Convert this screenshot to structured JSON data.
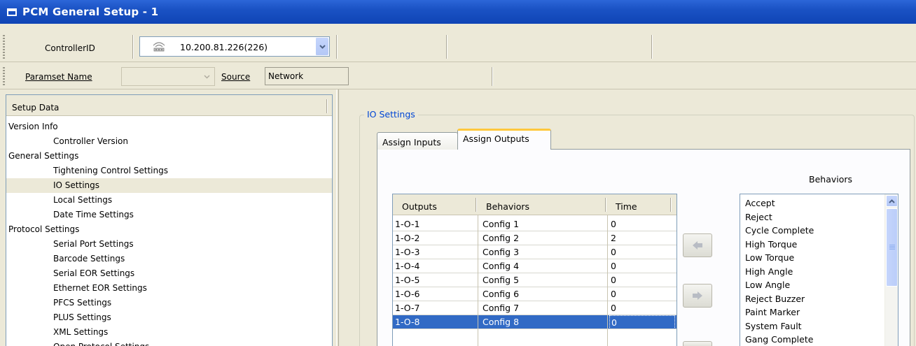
{
  "window": {
    "title": "PCM General Setup - 1"
  },
  "toolbar": {
    "controller_label": "ControllerID",
    "controller_value": "10.200.81.226(226)",
    "controller_icon": "network-icon",
    "paramset_label": "Paramset Name",
    "paramset_value": "",
    "source_label": "Source",
    "source_value": "Network"
  },
  "setup_tree": {
    "header": "Setup Data",
    "items": [
      {
        "label": "Version Info",
        "level": 0
      },
      {
        "label": "Controller Version",
        "level": 1
      },
      {
        "label": "General Settings",
        "level": 0
      },
      {
        "label": "Tightening Control Settings",
        "level": 1
      },
      {
        "label": "IO Settings",
        "level": 1,
        "selected": true
      },
      {
        "label": "Local Settings",
        "level": 1
      },
      {
        "label": "Date Time Settings",
        "level": 1
      },
      {
        "label": "Protocol Settings",
        "level": 0
      },
      {
        "label": "Serial Port Settings",
        "level": 1
      },
      {
        "label": "Barcode Settings",
        "level": 1
      },
      {
        "label": "Serial EOR Settings",
        "level": 1
      },
      {
        "label": "Ethernet EOR Settings",
        "level": 1
      },
      {
        "label": "PFCS Settings",
        "level": 1
      },
      {
        "label": "PLUS Settings",
        "level": 1
      },
      {
        "label": "XML Settings",
        "level": 1
      },
      {
        "label": "Open Protocol Settings",
        "level": 1
      }
    ]
  },
  "io_settings": {
    "group_title": "IO Settings",
    "tabs": [
      {
        "label": "Assign Inputs",
        "active": false
      },
      {
        "label": "Assign Outputs",
        "active": true
      }
    ],
    "outputs_table": {
      "columns": [
        "Outputs",
        "Behaviors",
        "Time"
      ],
      "rows": [
        [
          "1-O-1",
          "Config 1",
          "0"
        ],
        [
          "1-O-2",
          "Config 2",
          "2"
        ],
        [
          "1-O-3",
          "Config 3",
          "0"
        ],
        [
          "1-O-4",
          "Config 4",
          "0"
        ],
        [
          "1-O-5",
          "Config 5",
          "0"
        ],
        [
          "1-O-6",
          "Config 6",
          "0"
        ],
        [
          "1-O-7",
          "Config 7",
          "0"
        ],
        [
          "1-O-8",
          "Config 8",
          "0"
        ]
      ],
      "selected_row": 7
    },
    "behaviors": {
      "caption": "Behaviors",
      "items": [
        "Accept",
        "Reject",
        "Cycle Complete",
        "High Torque",
        "Low Torque",
        "High Angle",
        "Low Angle",
        "Reject Buzzer",
        "Paint Marker",
        "System Fault",
        "Gang Complete"
      ]
    },
    "buttons": {
      "assign_left_icon": "arrow-left-icon",
      "assign_right_icon": "arrow-right-icon"
    }
  },
  "colors": {
    "titlebar": "#0f44b5",
    "selection": "#316ac5",
    "group_title": "#0046d5",
    "tab_highlight": "#ffc83c"
  }
}
